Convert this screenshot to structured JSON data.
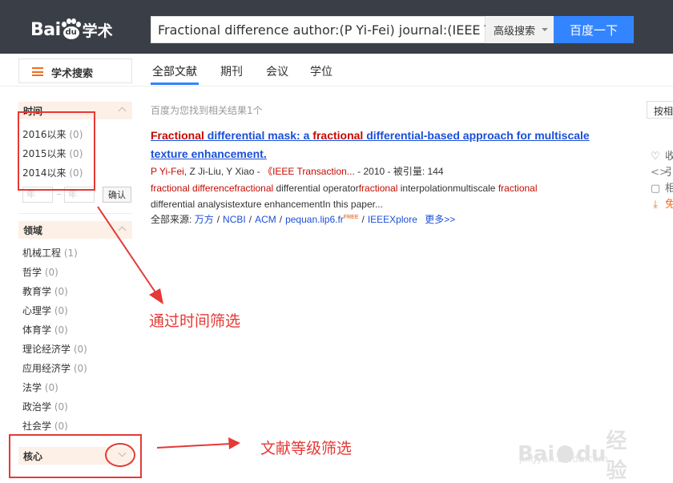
{
  "header": {
    "logo_text_left": "Bai",
    "logo_text_paw": "du",
    "logo_text_right": "学术",
    "search_value": "Fractional difference author:(P Yi-Fei) journal:(IEEE Tran",
    "advanced_search_label": "高级搜索",
    "search_button_label": "百度一下",
    "brand_color": "#3385ff",
    "header_bg": "#3a3f47"
  },
  "nav": {
    "menu_label": "学术搜索",
    "tabs": [
      {
        "label": "全部文献",
        "active": true
      },
      {
        "label": "期刊",
        "active": false
      },
      {
        "label": "会议",
        "active": false
      },
      {
        "label": "学位",
        "active": false
      }
    ]
  },
  "sidebar": {
    "time": {
      "title": "时间",
      "items": [
        {
          "label": "2016以来",
          "count": "(0)"
        },
        {
          "label": "2015以来",
          "count": "(0)"
        },
        {
          "label": "2014以来",
          "count": "(0)"
        }
      ],
      "range_from_placeholder": "年",
      "range_to_placeholder": "年",
      "confirm_label": "确认"
    },
    "field": {
      "title": "领域",
      "items": [
        {
          "label": "机械工程",
          "count": "(1)"
        },
        {
          "label": "哲学",
          "count": "(0)"
        },
        {
          "label": "教育学",
          "count": "(0)"
        },
        {
          "label": "心理学",
          "count": "(0)"
        },
        {
          "label": "体育学",
          "count": "(0)"
        },
        {
          "label": "理论经济学",
          "count": "(0)"
        },
        {
          "label": "应用经济学",
          "count": "(0)"
        },
        {
          "label": "法学",
          "count": "(0)"
        },
        {
          "label": "政治学",
          "count": "(0)"
        },
        {
          "label": "社会学",
          "count": "(0)"
        }
      ]
    },
    "core": {
      "title": "核心"
    }
  },
  "results": {
    "count_text": "百度为您找到相关结果1个",
    "sort_label": "按相",
    "item": {
      "title_parts": [
        {
          "text": "Fractional",
          "hl": true
        },
        {
          "text": " differential mask: a ",
          "hl": false
        },
        {
          "text": "fractional",
          "hl": true
        },
        {
          "text": " differential-based approach for multiscale texture enhancement.",
          "hl": false
        }
      ],
      "author1": "P Yi-Fei",
      "author2": "Z Ji-Liu",
      "author3": "Y Xiao",
      "venue": "《IEEE Transaction...",
      "year": "2010",
      "cited_label": "被引量:",
      "cited_count": "144",
      "abstract_parts": [
        {
          "text": "fractional differencefractional",
          "hl": true
        },
        {
          "text": " differential operator",
          "hl": false
        },
        {
          "text": "fractional",
          "hl": true
        },
        {
          "text": " interpolationmultiscale ",
          "hl": false
        },
        {
          "text": "fractional",
          "hl": true
        },
        {
          "text": " differential analysistexture enhancementIn this paper...",
          "hl": false
        }
      ],
      "sources_label": "全部来源:",
      "sources": [
        "万方",
        "NCBI",
        "ACM",
        "pequan.lip6.fr",
        "IEEEXplore"
      ],
      "free_tag": "FREE",
      "more_label": "更多>>"
    },
    "tools": [
      {
        "icon": "heart-icon",
        "glyph": "♡",
        "label": "收"
      },
      {
        "icon": "code-icon",
        "glyph": "<>",
        "label": "引"
      },
      {
        "icon": "document-icon",
        "glyph": "▢",
        "label": "相"
      },
      {
        "icon": "download-icon",
        "glyph": "⤓",
        "label": "免"
      }
    ]
  },
  "annotations": {
    "time_filter_label": "通过时间筛选",
    "level_filter_label": "文献等级筛选",
    "color": "#e53935"
  },
  "watermark": {
    "top_left": "Bai",
    "top_mid": "du",
    "top_right": "经验",
    "bottom": "jingyan.baidu.com"
  }
}
